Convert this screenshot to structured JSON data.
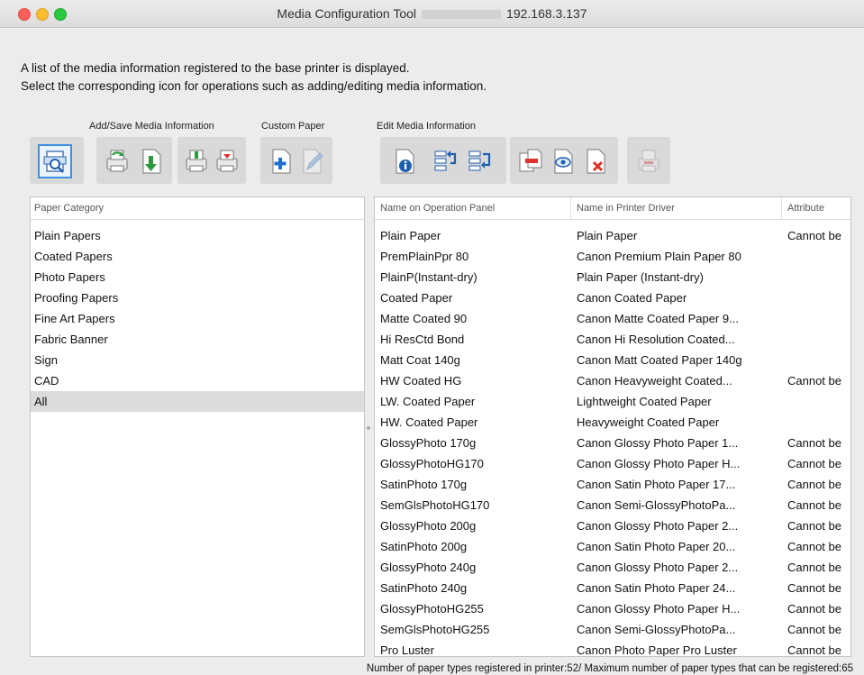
{
  "window": {
    "title_prefix": "Media Configuration Tool",
    "title_ip": "192.168.3.137"
  },
  "description": {
    "line1": "A list of the media information registered to the base printer is displayed.",
    "line2": "Select the corresponding icon for operations such as adding/editing media information."
  },
  "toolbar": {
    "add_save_label": "Add/Save Media Information",
    "custom_paper_label": "Custom Paper",
    "edit_label": "Edit Media Information"
  },
  "left_panel": {
    "header": "Paper Category",
    "items": [
      "Plain Papers",
      "Coated Papers",
      "Photo Papers",
      "Proofing Papers",
      "Fine Art Papers",
      "Fabric Banner",
      "Sign",
      "CAD",
      "All"
    ],
    "selected": "All"
  },
  "right_panel": {
    "headers": [
      "Name on Operation Panel",
      "Name in Printer Driver",
      "Attribute"
    ],
    "rows": [
      [
        "Plain Paper",
        "Plain Paper",
        "Cannot be"
      ],
      [
        "PremPlainPpr 80",
        "Canon Premium Plain Paper 80",
        ""
      ],
      [
        "PlainP(Instant-dry)",
        "Plain Paper (Instant-dry)",
        ""
      ],
      [
        "Coated Paper",
        "Canon Coated Paper",
        ""
      ],
      [
        "Matte Coated 90",
        "Canon Matte Coated Paper 9...",
        ""
      ],
      [
        "Hi ResCtd Bond",
        "Canon Hi Resolution Coated...",
        ""
      ],
      [
        "Matt Coat 140g",
        "Canon Matt Coated Paper 140g",
        ""
      ],
      [
        "HW Coated HG",
        "Canon Heavyweight Coated...",
        "Cannot be"
      ],
      [
        "LW. Coated Paper",
        "Lightweight Coated Paper",
        ""
      ],
      [
        "HW. Coated Paper",
        "Heavyweight Coated Paper",
        ""
      ],
      [
        "GlossyPhoto 170g",
        "Canon Glossy Photo Paper 1...",
        "Cannot be"
      ],
      [
        "GlossyPhotoHG170",
        "Canon Glossy Photo Paper H...",
        "Cannot be"
      ],
      [
        "SatinPhoto 170g",
        "Canon Satin Photo Paper 17...",
        "Cannot be"
      ],
      [
        "SemGlsPhotoHG170",
        "Canon Semi-GlossyPhotoPa...",
        "Cannot be"
      ],
      [
        "GlossyPhoto 200g",
        "Canon Glossy Photo Paper 2...",
        "Cannot be"
      ],
      [
        "SatinPhoto 200g",
        "Canon Satin Photo Paper 20...",
        "Cannot be"
      ],
      [
        "GlossyPhoto 240g",
        "Canon Glossy Photo Paper 2...",
        "Cannot be"
      ],
      [
        "SatinPhoto 240g",
        "Canon Satin Photo Paper 24...",
        "Cannot be"
      ],
      [
        "GlossyPhotoHG255",
        "Canon Glossy Photo Paper H...",
        "Cannot be"
      ],
      [
        "SemGlsPhotoHG255",
        "Canon Semi-GlossyPhotoPa...",
        "Cannot be"
      ],
      [
        "Pro Luster",
        "Canon Photo Paper Pro Luster",
        "Cannot be"
      ]
    ]
  },
  "footer": {
    "text": "Number of paper types registered in printer:52/ Maximum number of paper types that can be registered:65"
  }
}
